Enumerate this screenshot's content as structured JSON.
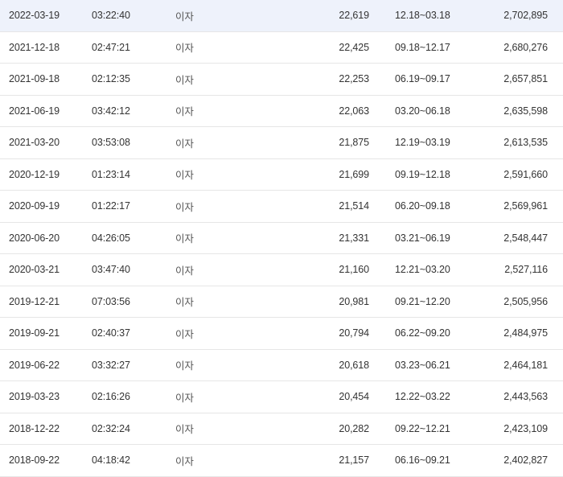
{
  "colors": {
    "highlight_row_bg": "#eef2fb",
    "row_divider": "#e6e6e6",
    "text": "#333333"
  },
  "rows": [
    {
      "date": "2022-03-19",
      "time": "03:22:40",
      "type": "이자",
      "amount": "22,619",
      "period": "12.18~03.18",
      "balance": "2,702,895"
    },
    {
      "date": "2021-12-18",
      "time": "02:47:21",
      "type": "이자",
      "amount": "22,425",
      "period": "09.18~12.17",
      "balance": "2,680,276"
    },
    {
      "date": "2021-09-18",
      "time": "02:12:35",
      "type": "이자",
      "amount": "22,253",
      "period": "06.19~09.17",
      "balance": "2,657,851"
    },
    {
      "date": "2021-06-19",
      "time": "03:42:12",
      "type": "이자",
      "amount": "22,063",
      "period": "03.20~06.18",
      "balance": "2,635,598"
    },
    {
      "date": "2021-03-20",
      "time": "03:53:08",
      "type": "이자",
      "amount": "21,875",
      "period": "12.19~03.19",
      "balance": "2,613,535"
    },
    {
      "date": "2020-12-19",
      "time": "01:23:14",
      "type": "이자",
      "amount": "21,699",
      "period": "09.19~12.18",
      "balance": "2,591,660"
    },
    {
      "date": "2020-09-19",
      "time": "01:22:17",
      "type": "이자",
      "amount": "21,514",
      "period": "06.20~09.18",
      "balance": "2,569,961"
    },
    {
      "date": "2020-06-20",
      "time": "04:26:05",
      "type": "이자",
      "amount": "21,331",
      "period": "03.21~06.19",
      "balance": "2,548,447"
    },
    {
      "date": "2020-03-21",
      "time": "03:47:40",
      "type": "이자",
      "amount": "21,160",
      "period": "12.21~03.20",
      "balance": "2,527,116"
    },
    {
      "date": "2019-12-21",
      "time": "07:03:56",
      "type": "이자",
      "amount": "20,981",
      "period": "09.21~12.20",
      "balance": "2,505,956"
    },
    {
      "date": "2019-09-21",
      "time": "02:40:37",
      "type": "이자",
      "amount": "20,794",
      "period": "06.22~09.20",
      "balance": "2,484,975"
    },
    {
      "date": "2019-06-22",
      "time": "03:32:27",
      "type": "이자",
      "amount": "20,618",
      "period": "03.23~06.21",
      "balance": "2,464,181"
    },
    {
      "date": "2019-03-23",
      "time": "02:16:26",
      "type": "이자",
      "amount": "20,454",
      "period": "12.22~03.22",
      "balance": "2,443,563"
    },
    {
      "date": "2018-12-22",
      "time": "02:32:24",
      "type": "이자",
      "amount": "20,282",
      "period": "09.22~12.21",
      "balance": "2,423,109"
    },
    {
      "date": "2018-09-22",
      "time": "04:18:42",
      "type": "이자",
      "amount": "21,157",
      "period": "06.16~09.21",
      "balance": "2,402,827"
    }
  ]
}
